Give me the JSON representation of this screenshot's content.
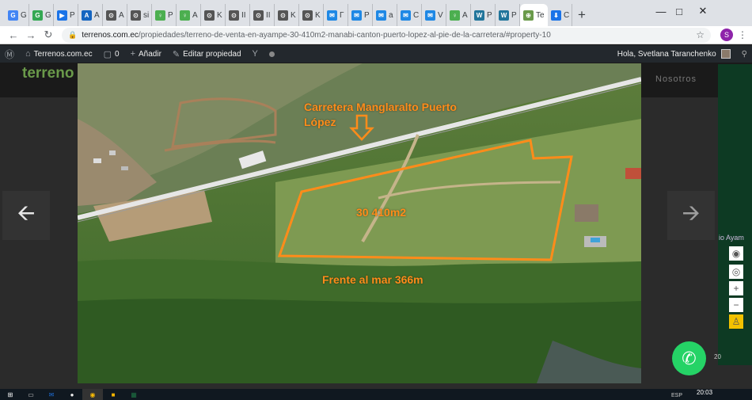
{
  "browser": {
    "tabs": [
      {
        "label": "G",
        "fav": "G",
        "color": "#4285f4"
      },
      {
        "label": "G",
        "fav": "G",
        "color": "#34a853"
      },
      {
        "label": "P",
        "fav": "▶",
        "color": "#1a73e8"
      },
      {
        "label": "A",
        "fav": "A",
        "color": "#1565c0"
      },
      {
        "label": "A",
        "fav": "⊙",
        "color": "#555555"
      },
      {
        "label": "si",
        "fav": "⊙",
        "color": "#555555"
      },
      {
        "label": "P",
        "fav": "♀",
        "color": "#4caf50"
      },
      {
        "label": "A",
        "fav": "♀",
        "color": "#4caf50"
      },
      {
        "label": "K",
        "fav": "⊙",
        "color": "#555555"
      },
      {
        "label": "II",
        "fav": "⊙",
        "color": "#555555"
      },
      {
        "label": "II",
        "fav": "⊙",
        "color": "#555555"
      },
      {
        "label": "K",
        "fav": "⊙",
        "color": "#555555"
      },
      {
        "label": "K",
        "fav": "⊙",
        "color": "#555555"
      },
      {
        "label": "Г",
        "fav": "✉",
        "color": "#1e88e5"
      },
      {
        "label": "P",
        "fav": "✉",
        "color": "#1e88e5"
      },
      {
        "label": "a",
        "fav": "✉",
        "color": "#1e88e5"
      },
      {
        "label": "C",
        "fav": "✉",
        "color": "#1e88e5"
      },
      {
        "label": "V",
        "fav": "✉",
        "color": "#1e88e5"
      },
      {
        "label": "A",
        "fav": "♀",
        "color": "#4caf50"
      },
      {
        "label": "P",
        "fav": "W",
        "color": "#21759b"
      },
      {
        "label": "P",
        "fav": "W",
        "color": "#21759b"
      }
    ],
    "active_tab": {
      "label": "Te",
      "fav": "⊕",
      "color": "#6a9a4a"
    },
    "last_tab": {
      "label": "C",
      "fav": "⬇",
      "color": "#1a73e8"
    },
    "url_host": "terrenos.com.ec",
    "url_path": "/propiedades/terreno-de-venta-en-ayampe-30-410m2-manabi-canton-puerto-lopez-al-pie-de-la-carretera/#property-10",
    "profile_initial": "S"
  },
  "wp_admin_bar": {
    "site_name": "Terrenos.com.ec",
    "comments_count": "0",
    "add_label": "Añadir",
    "edit_label": "Editar propiedad",
    "greeting": "Hola, Svetlana Taranchenko"
  },
  "site": {
    "logo_text": "terreno",
    "nav_item": "Nosotros",
    "map_label": "io Ayam"
  },
  "photo": {
    "road_label_line1": "Carretera Manglaralto Puerto",
    "road_label_line2": "López",
    "area_label": "30 410m2",
    "frontage_label": "Frente al mar 366m"
  },
  "map_scale": "20",
  "taskbar": {
    "lang": "ESP",
    "time": "20:03"
  },
  "colors": {
    "annotation": "#ff8c1a",
    "wp_bar": "#23282d"
  }
}
